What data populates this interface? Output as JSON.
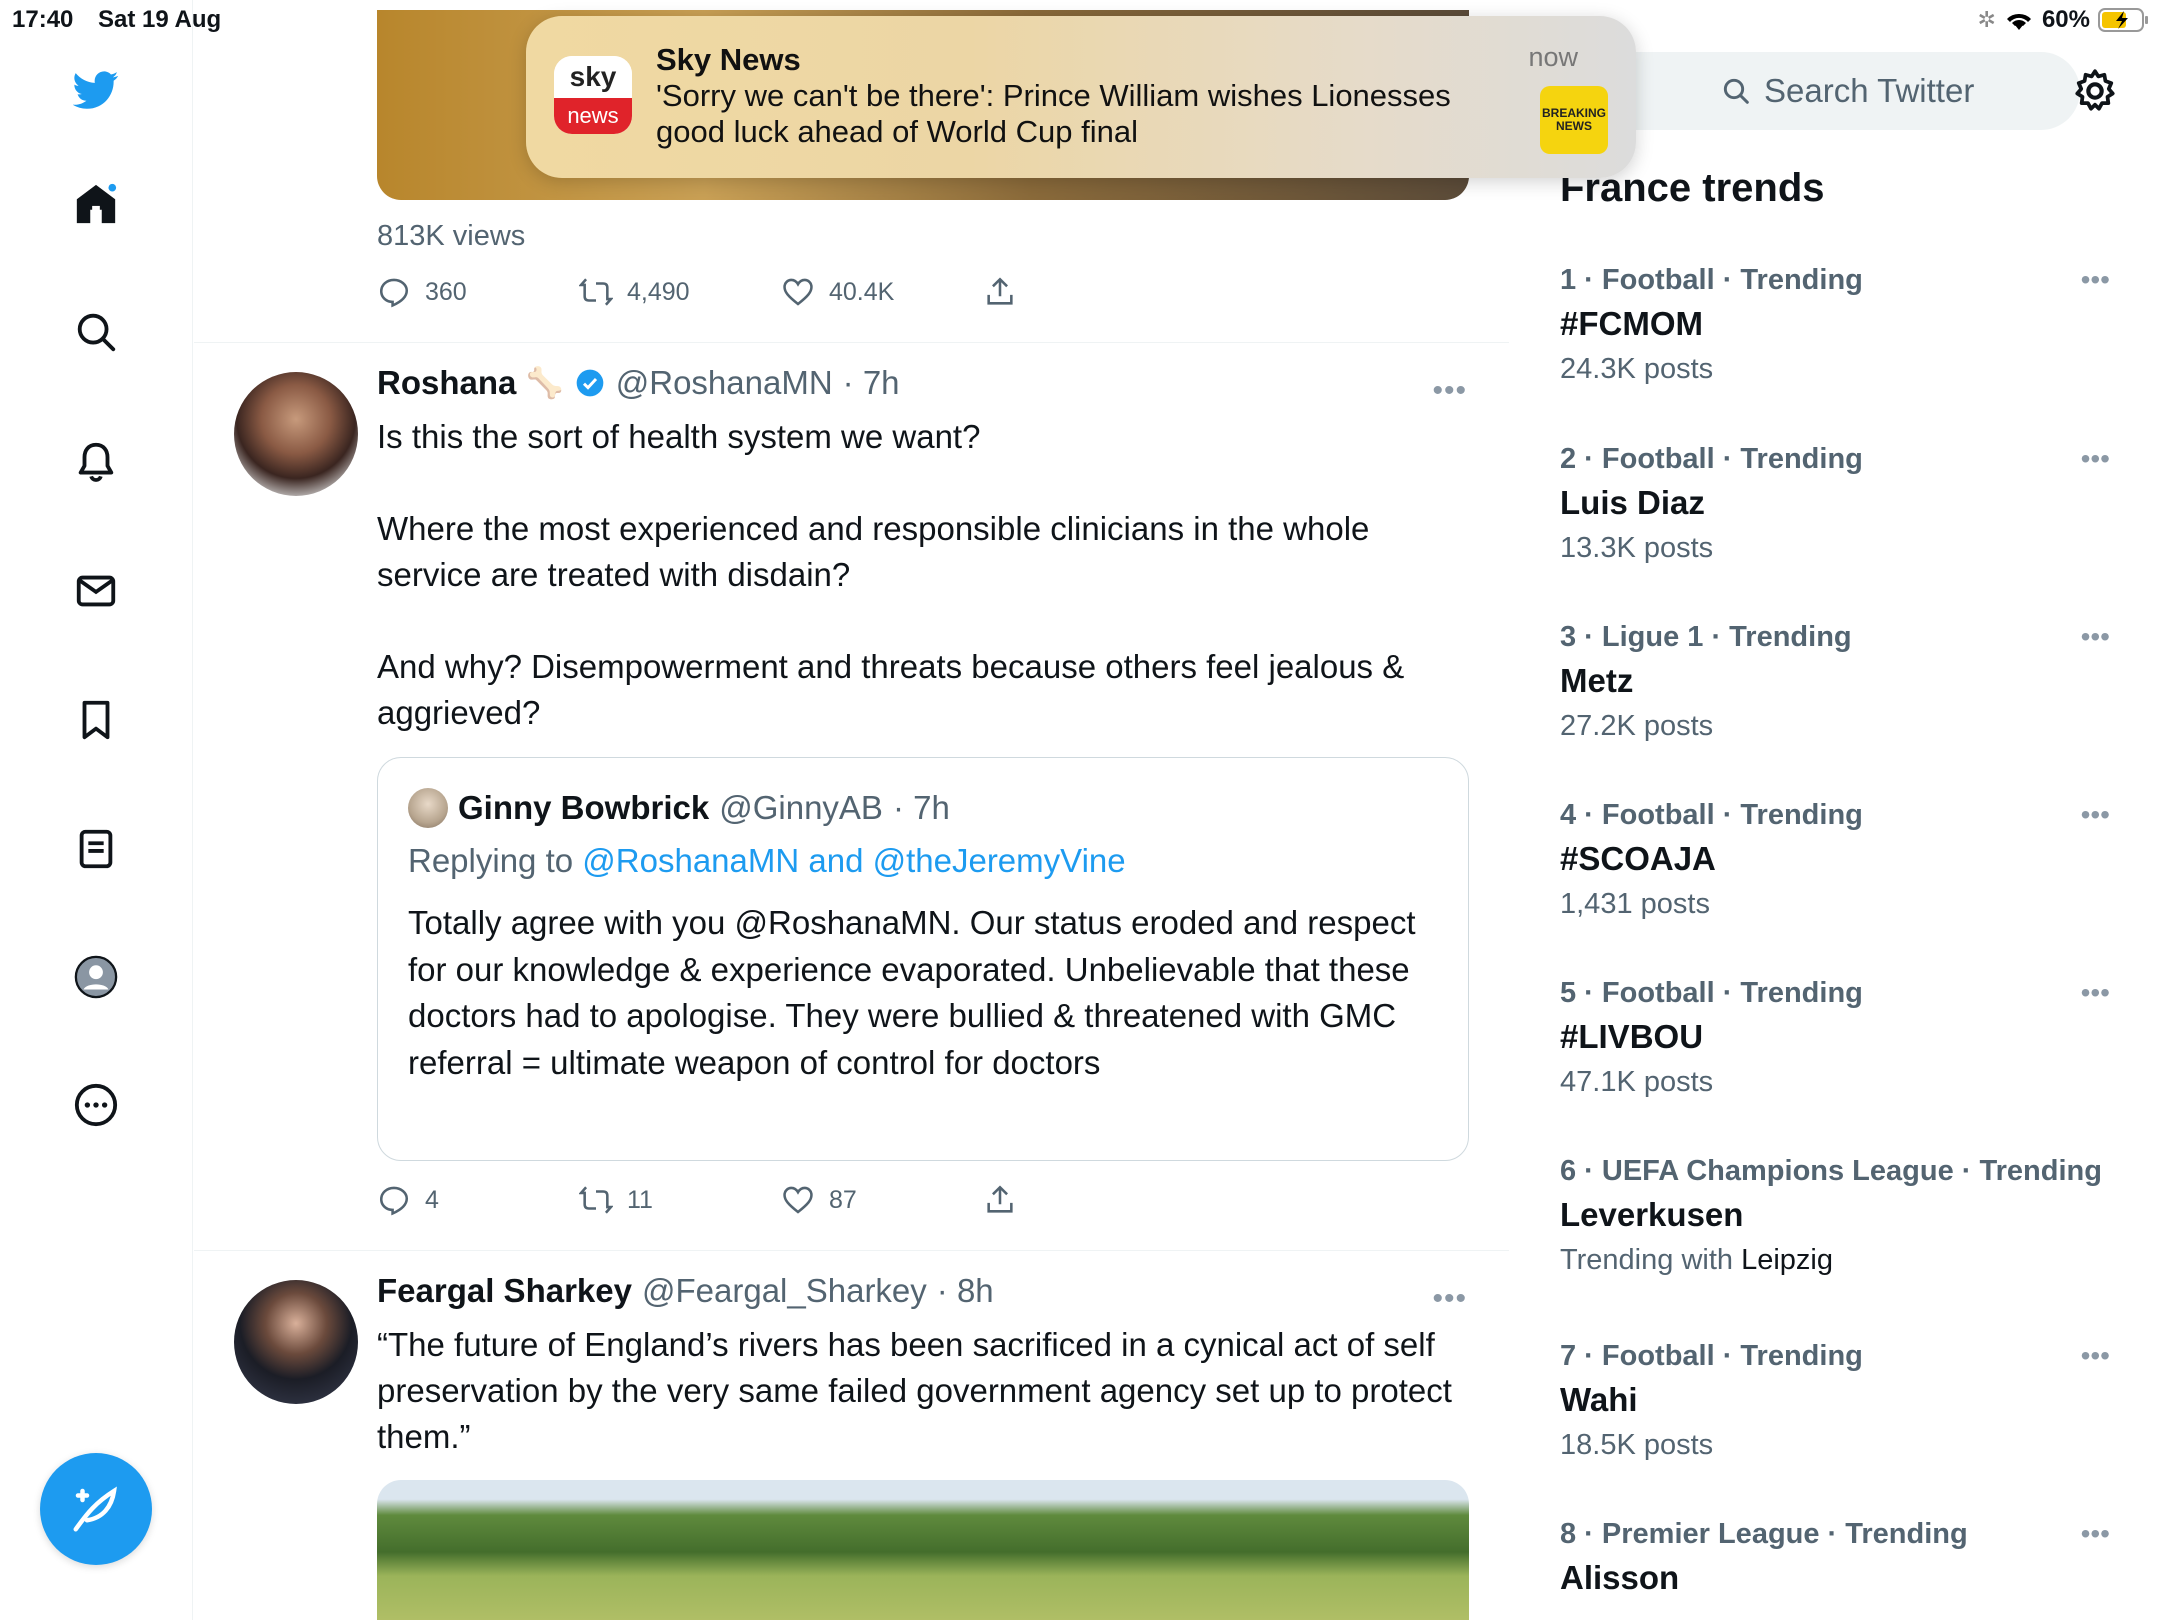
{
  "status_bar": {
    "time": "17:40",
    "date": "Sat 19 Aug",
    "battery": "60%"
  },
  "nav": {
    "items": [
      "home-icon",
      "search-icon",
      "bell-icon",
      "mail-icon",
      "bookmark-icon",
      "list-icon",
      "profile-icon",
      "more-icon"
    ],
    "compose": "compose-icon"
  },
  "colors": {
    "brand": "#1d9bf0",
    "text": "#0f1419",
    "muted": "#536471"
  },
  "notification": {
    "app": "Sky News",
    "icon_top": "sky",
    "icon_bottom": "news",
    "body": "'Sorry we can't be there': Prince William wishes Lionesses good luck ahead of World Cup final",
    "time": "now",
    "thumb": "BREAKING NEWS"
  },
  "tweet0": {
    "views": "813K views",
    "replies": "360",
    "retweets": "4,490",
    "likes": "40.4K"
  },
  "tweet1": {
    "name": "Roshana",
    "handle": "@RoshanaMN",
    "time": "· 7h",
    "text": "Is this the sort of health system we want?\n\nWhere the most experienced and responsible clinicians in the whole service are treated with disdain?\n\nAnd why? Disempowerment and threats because others feel jealous & aggrieved?",
    "quote": {
      "name": "Ginny Bowbrick",
      "handle": "@GinnyAB",
      "time": "· 7h",
      "replying_prefix": "Replying to",
      "replying_to": "@RoshanaMN and @theJeremyVine",
      "text": "Totally agree with you @RoshanaMN. Our status eroded and respect for our knowledge & experience evaporated. Unbelievable that these doctors had to apologise. They were bullied & threatened with GMC referral = ultimate weapon of control for doctors"
    },
    "replies": "4",
    "retweets": "11",
    "likes": "87"
  },
  "tweet2": {
    "name": "Feargal Sharkey",
    "handle": "@Feargal_Sharkey",
    "time": "· 8h",
    "text": "“The future of England’s rivers has been sacrificed in a cynical act of self preservation by the very same failed government agency set up to protect them.”"
  },
  "sidebar": {
    "search_placeholder": "Search Twitter",
    "trends_title": "France trends",
    "trends": [
      {
        "meta": "1 · Football · Trending",
        "name": "#FCMOM",
        "posts": "24.3K posts"
      },
      {
        "meta": "2 · Football · Trending",
        "name": "Luis Diaz",
        "posts": "13.3K posts"
      },
      {
        "meta": "3 · Ligue 1 · Trending",
        "name": "Metz",
        "posts": "27.2K posts"
      },
      {
        "meta": "4 · Football · Trending",
        "name": "#SCOAJA",
        "posts": "1,431 posts"
      },
      {
        "meta": "5 · Football · Trending",
        "name": "#LIVBOU",
        "posts": "47.1K posts"
      },
      {
        "meta": "6 · UEFA Champions League · Trending",
        "name": "Leverkusen",
        "posts_prefix": "Trending with",
        "posts_with": "Leipzig"
      },
      {
        "meta": "7 · Football · Trending",
        "name": "Wahi",
        "posts": "18.5K posts"
      },
      {
        "meta": "8 · Premier League · Trending",
        "name": "Alisson"
      }
    ]
  }
}
